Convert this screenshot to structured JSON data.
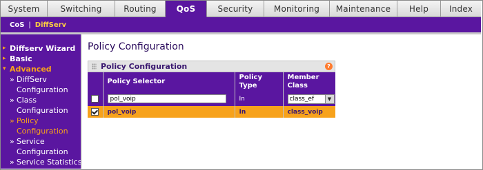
{
  "nav": {
    "tabs": [
      {
        "label": "System"
      },
      {
        "label": "Switching"
      },
      {
        "label": "Routing"
      },
      {
        "label": "QoS"
      },
      {
        "label": "Security"
      },
      {
        "label": "Monitoring"
      },
      {
        "label": "Maintenance"
      },
      {
        "label": "Help"
      },
      {
        "label": "Index"
      }
    ],
    "active_tab": "QoS",
    "subnav": {
      "cos": "CoS",
      "separator": "|",
      "diffserv": "DiffServ"
    }
  },
  "sidebar": {
    "diffserv_wizard": "Diffserv Wizard",
    "basic": "Basic",
    "advanced": "Advanced",
    "diffserv_configuration": [
      "DiffServ",
      "Configuration"
    ],
    "class_configuration": [
      "Class",
      "Configuration"
    ],
    "policy_configuration": [
      "Policy",
      "Configuration"
    ],
    "service_configuration": [
      "Service",
      "Configuration"
    ],
    "service_statistics": "Service Statistics"
  },
  "page": {
    "title": "Policy Configuration"
  },
  "panel": {
    "title": "Policy Configuration",
    "help": "?",
    "columns": {
      "selector": "Policy Selector",
      "type": [
        "Policy",
        "Type"
      ],
      "member": [
        "Member",
        "Class"
      ]
    },
    "input_row": {
      "selector_value": "pol_voip",
      "type": "In",
      "member_selected": "class_ef"
    },
    "rows": [
      {
        "selector": "pol_voip",
        "type": "In",
        "member": "class_voip",
        "checked": true
      }
    ]
  },
  "colors": {
    "purple": "#5a16a0",
    "orange": "#f7a21b"
  }
}
